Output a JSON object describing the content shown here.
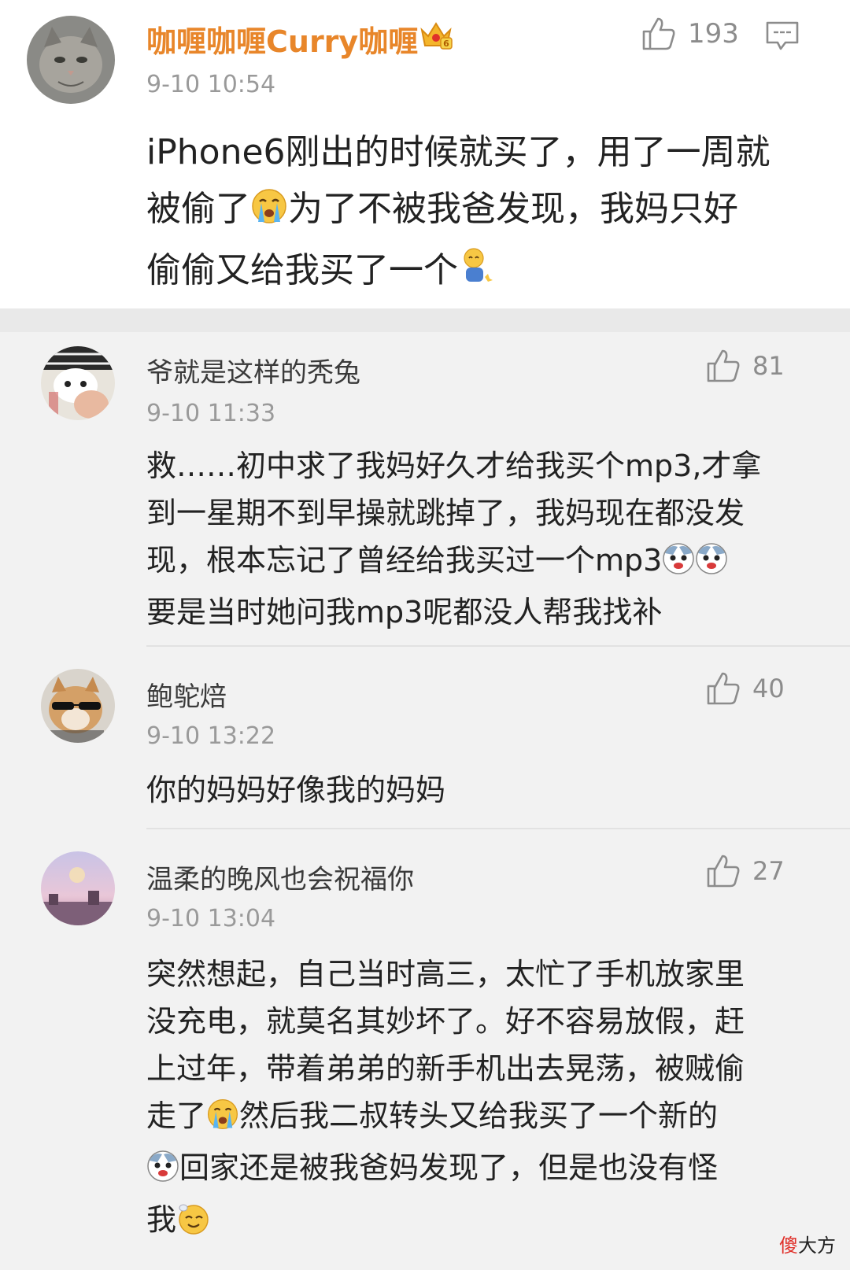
{
  "main": {
    "username": "咖喱咖喱Curry咖喱",
    "time": "9-10 10:54",
    "likes": "193",
    "lines": [
      {
        "before": "iPhone6刚出的时候就买了，用了一周就",
        "after": ""
      },
      {
        "before": "被偷了",
        "after": "为了不被我爸发现，我妈只好"
      },
      {
        "before": "偷偷又给我买了一个",
        "after": ""
      }
    ]
  },
  "replies": [
    {
      "username": "爷就是这样的秃兔",
      "time": "9-10 11:33",
      "likes": "81",
      "lines": [
        "救……初中求了我妈好久才给我买个mp3,才拿",
        "到一星期不到早操就跳掉了，我妈现在都没发",
        "现，根本忘记了曾经给我买过一个mp3",
        "要是当时她问我mp3呢都没人帮我找补"
      ]
    },
    {
      "username": "鲍鸵焙",
      "time": "9-10 13:22",
      "likes": "40",
      "lines": [
        "你的妈妈好像我的妈妈"
      ]
    },
    {
      "username": "温柔的晚风也会祝福你",
      "time": "9-10 13:04",
      "likes": "27",
      "lines": [
        {
          "before": "突然想起，自己当时高三，太忙了手机放家里",
          "after": ""
        },
        {
          "before": "没充电，就莫名其妙坏了。好不容易放假，赶",
          "after": ""
        },
        {
          "before": "上过年，带着弟弟的新手机出去晃荡，被贼偷",
          "after": ""
        },
        {
          "before": "走了",
          "after": "然后我二叔转头又给我买了一个新的"
        },
        {
          "before": "",
          "after": "回家还是被我爸妈发现了，但是也没有怪"
        },
        {
          "before": "我",
          "after": ""
        }
      ]
    }
  ],
  "watermark": {
    "part1": "傻",
    "part2": "大方"
  }
}
